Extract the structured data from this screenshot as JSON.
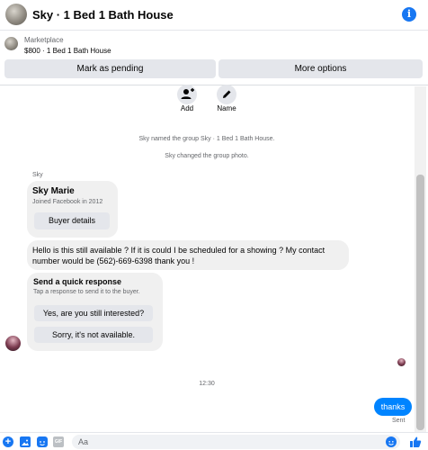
{
  "header": {
    "title": "Sky · 1 Bed 1 Bath House",
    "info_icon": "info-icon",
    "info_glyph": "i"
  },
  "marketplace": {
    "label": "Marketplace",
    "listing": "$800 · 1 Bed 1 Bath House",
    "mark_pending_label": "Mark as pending",
    "more_options_label": "More options"
  },
  "actions": {
    "add_label": "Add",
    "name_label": "Name"
  },
  "system_messages": {
    "named_group": "Sky named the group Sky · 1 Bed 1 Bath House.",
    "changed_photo": "Sky changed the group photo."
  },
  "conversation": {
    "sender_name": "Sky",
    "profile_card": {
      "name": "Sky Marie",
      "joined": "Joined Facebook in 2012",
      "buyer_details_label": "Buyer details"
    },
    "message1": "Hello is this still available ? If it is could I be scheduled for a showing ? My contact number would be (562)-669-6398 thank you !",
    "quick_response": {
      "title": "Send a quick response",
      "subtitle": "Tap a response to send it to the buyer.",
      "option1": "Yes, are you still interested?",
      "option2": "Sorry, it's not available."
    },
    "timestamp": "12:30",
    "sent_message": "thanks",
    "sent_status": "Sent"
  },
  "composer": {
    "placeholder": "Aa",
    "plus_glyph": "+",
    "gif_glyph": "GIF"
  },
  "colors": {
    "accent": "#1877f2",
    "sent_bubble": "#0084ff",
    "bubble_grey": "#f0f0f0"
  }
}
